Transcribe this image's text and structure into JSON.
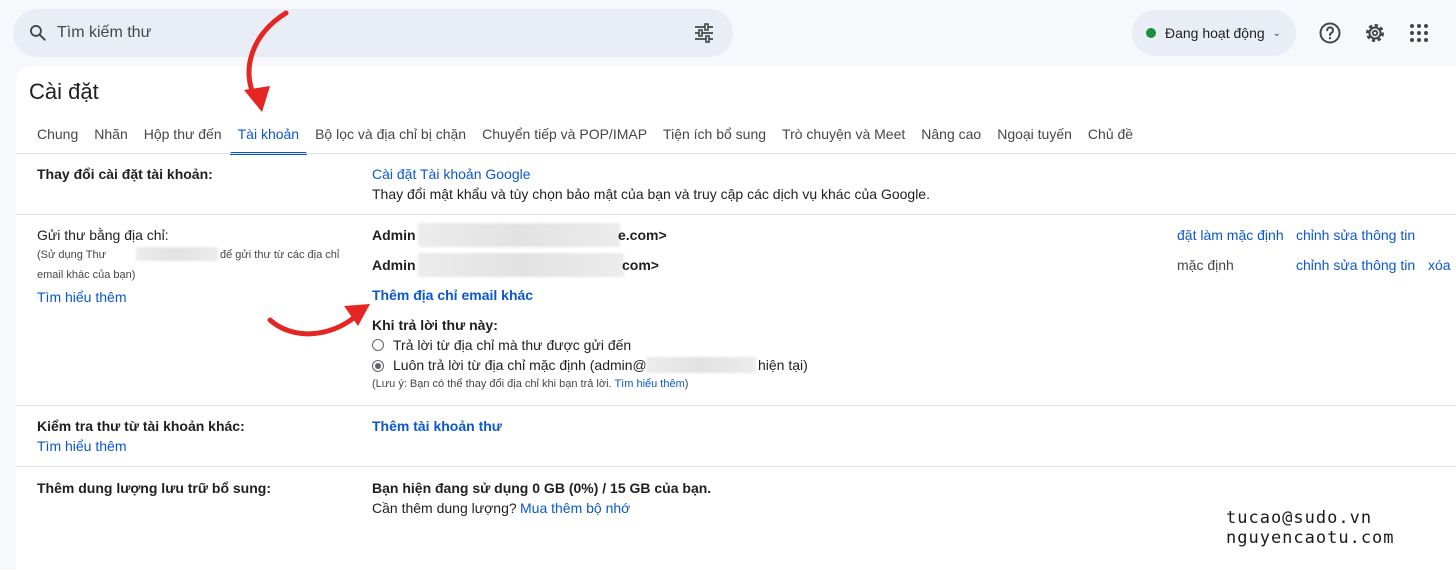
{
  "search": {
    "placeholder": "Tìm kiếm thư"
  },
  "status": {
    "label": "Đang hoạt động"
  },
  "page_title": "Cài đặt",
  "tabs": [
    {
      "label": "Chung"
    },
    {
      "label": "Nhãn"
    },
    {
      "label": "Hộp thư đến"
    },
    {
      "label": "Tài khoản",
      "active": true
    },
    {
      "label": "Bộ lọc và địa chỉ bị chặn"
    },
    {
      "label": "Chuyển tiếp và POP/IMAP"
    },
    {
      "label": "Tiện ích bổ sung"
    },
    {
      "label": "Trò chuyện và Meet"
    },
    {
      "label": "Nâng cao"
    },
    {
      "label": "Ngoại tuyến"
    },
    {
      "label": "Chủ đề"
    }
  ],
  "account_settings": {
    "label": "Thay đổi cài đặt tài khoản:",
    "link": "Cài đặt Tài khoản Google",
    "desc": "Thay đổi mật khẩu và tùy chọn bảo mật của bạn và truy cập các dịch vụ khác của Google."
  },
  "send_as": {
    "label": "Gửi thư bằng địa chỉ:",
    "note_a": "(Sử dụng Thư",
    "note_b": "để gửi thư từ các địa chỉ",
    "note_c": "email khác của bạn)",
    "learn_more": "Tìm hiểu thêm",
    "addresses": [
      {
        "name": "Admin",
        "suffix": "e.com>",
        "action_left": "đặt làm mặc định",
        "edit": "chỉnh sửa thông tin",
        "delete": ""
      },
      {
        "name": "Admin",
        "suffix": "com>",
        "action_left": "mặc định",
        "edit": "chỉnh sửa thông tin",
        "delete": "xóa"
      }
    ],
    "add_link": "Thêm địa chỉ email khác",
    "reply_label": "Khi trả lời thư này:",
    "option_1": "Trả lời từ địa chỉ mà thư được gửi đến",
    "option_2_a": "Luôn trả lời từ địa chỉ mặc định (admin@",
    "option_2_b": "hiện tại)",
    "footnote": "(Lưu ý: Bạn có thể thay đổi địa chỉ khi bạn trả lời.",
    "footnote_link": "Tìm hiểu thêm",
    "footnote_end": ")"
  },
  "check_mail": {
    "label": "Kiểm tra thư từ tài khoản khác:",
    "learn_more": "Tìm hiểu thêm",
    "link": "Thêm tài khoản thư"
  },
  "storage": {
    "label": "Thêm dung lượng lưu trữ bổ sung:",
    "usage": "Bạn hiện đang sử dụng 0 GB (0%) / 15 GB của bạn.",
    "need_more": "Cần thêm dung lượng?",
    "buy_link": "Mua thêm bộ nhớ"
  },
  "watermark": {
    "line1": "tucao@sudo.vn",
    "line2": "nguyencaotu.com"
  },
  "colors": {
    "accent": "#0b57d0",
    "annotation_arrow": "#e52521",
    "status_dot": "#1e8e3e"
  }
}
